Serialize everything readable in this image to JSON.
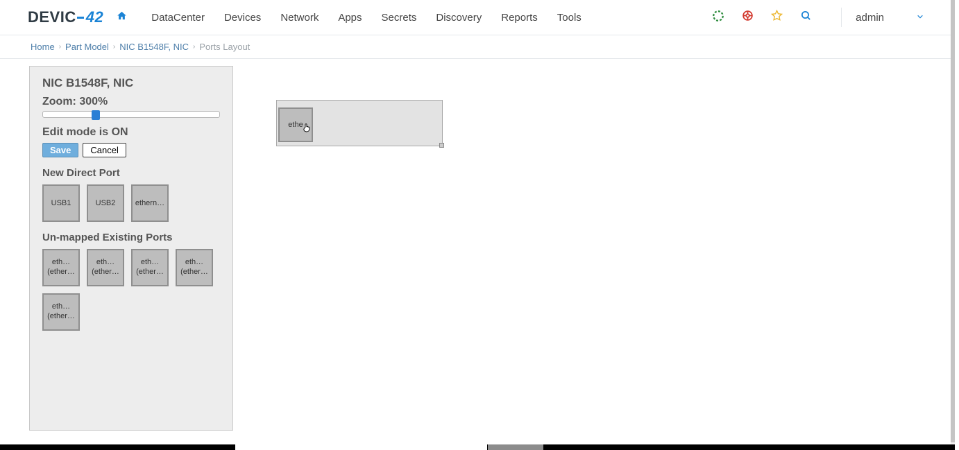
{
  "brand": {
    "name_a": "DEVIC",
    "name_b": "42"
  },
  "nav": {
    "items": [
      "DataCenter",
      "Devices",
      "Network",
      "Apps",
      "Secrets",
      "Discovery",
      "Reports",
      "Tools"
    ]
  },
  "user": {
    "name": "admin"
  },
  "breadcrumb": {
    "home": "Home",
    "part_model": "Part Model",
    "nic": "NIC B1548F, NIC",
    "current": "Ports Layout"
  },
  "panel": {
    "title": "NIC B1548F, NIC",
    "zoom_label": "Zoom: 300%",
    "zoom_percent": 300,
    "edit_mode_label": "Edit mode is ON",
    "save_label": "Save",
    "cancel_label": "Cancel",
    "new_direct_port_header": "New Direct Port",
    "direct_ports": [
      "USB1",
      "USB2",
      "ethern…"
    ],
    "unmapped_header": "Un-mapped Existing Ports",
    "unmapped_ports": [
      {
        "line1": "eth…",
        "line2": "(ether…"
      },
      {
        "line1": "eth…",
        "line2": "(ether…"
      },
      {
        "line1": "eth…",
        "line2": "(ether…"
      },
      {
        "line1": "eth…",
        "line2": "(ether…"
      },
      {
        "line1": "eth…",
        "line2": "(ether…"
      }
    ]
  },
  "canvas": {
    "placed_port_label": "ethe"
  }
}
